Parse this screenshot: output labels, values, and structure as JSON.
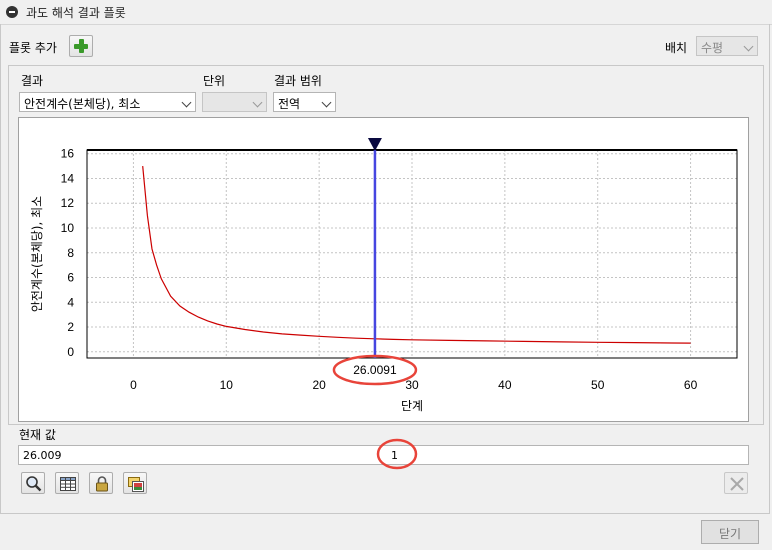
{
  "window": {
    "title": "과도 해석 결과 플롯"
  },
  "toolbar": {
    "add_plot_label": "플롯 추가",
    "layout_label": "배치",
    "layout_value": "수평"
  },
  "controls": {
    "result_label": "결과",
    "result_value": "안전계수(본체당), 최소",
    "unit_label": "단위",
    "unit_value": "",
    "range_label": "결과 범위",
    "range_value": "전역"
  },
  "current_value": {
    "label": "현재 값",
    "value": "26.009",
    "step": "1"
  },
  "footer": {
    "close_label": "닫기"
  },
  "icons": [
    "zoom-icon",
    "table-icon",
    "lock-icon",
    "image-icon",
    "clear-icon",
    "plus-icon",
    "cursor-marker-icon"
  ],
  "colors": {
    "series": "#cc0000",
    "cursor": "#4646e0",
    "highlight": "#e8443a"
  },
  "chart_data": {
    "type": "line",
    "xlabel": "단계",
    "ylabel": "안전계수(본체당), 최소",
    "xlim": [
      -5,
      65
    ],
    "ylim": [
      -0.5,
      16.3
    ],
    "xticks": [
      0,
      10,
      20,
      30,
      40,
      50,
      60
    ],
    "yticks": [
      0,
      2,
      4,
      6,
      8,
      10,
      12,
      14,
      16
    ],
    "grid": true,
    "cursor_x": 26.0091,
    "cursor_label": "26.0091",
    "series": [
      {
        "x": [
          1,
          1.5,
          2,
          2.5,
          3,
          4,
          5,
          6,
          7,
          8,
          9,
          10,
          12,
          14,
          16,
          18,
          20,
          22,
          24,
          26,
          28,
          30,
          34,
          38,
          42,
          46,
          50,
          54,
          58,
          60
        ],
        "values": [
          15.0,
          11.0,
          8.3,
          7.0,
          5.9,
          4.5,
          3.7,
          3.2,
          2.8,
          2.5,
          2.25,
          2.05,
          1.8,
          1.6,
          1.45,
          1.35,
          1.25,
          1.17,
          1.1,
          1.05,
          1.0,
          0.97,
          0.92,
          0.88,
          0.84,
          0.8,
          0.77,
          0.74,
          0.71,
          0.7
        ]
      }
    ]
  }
}
